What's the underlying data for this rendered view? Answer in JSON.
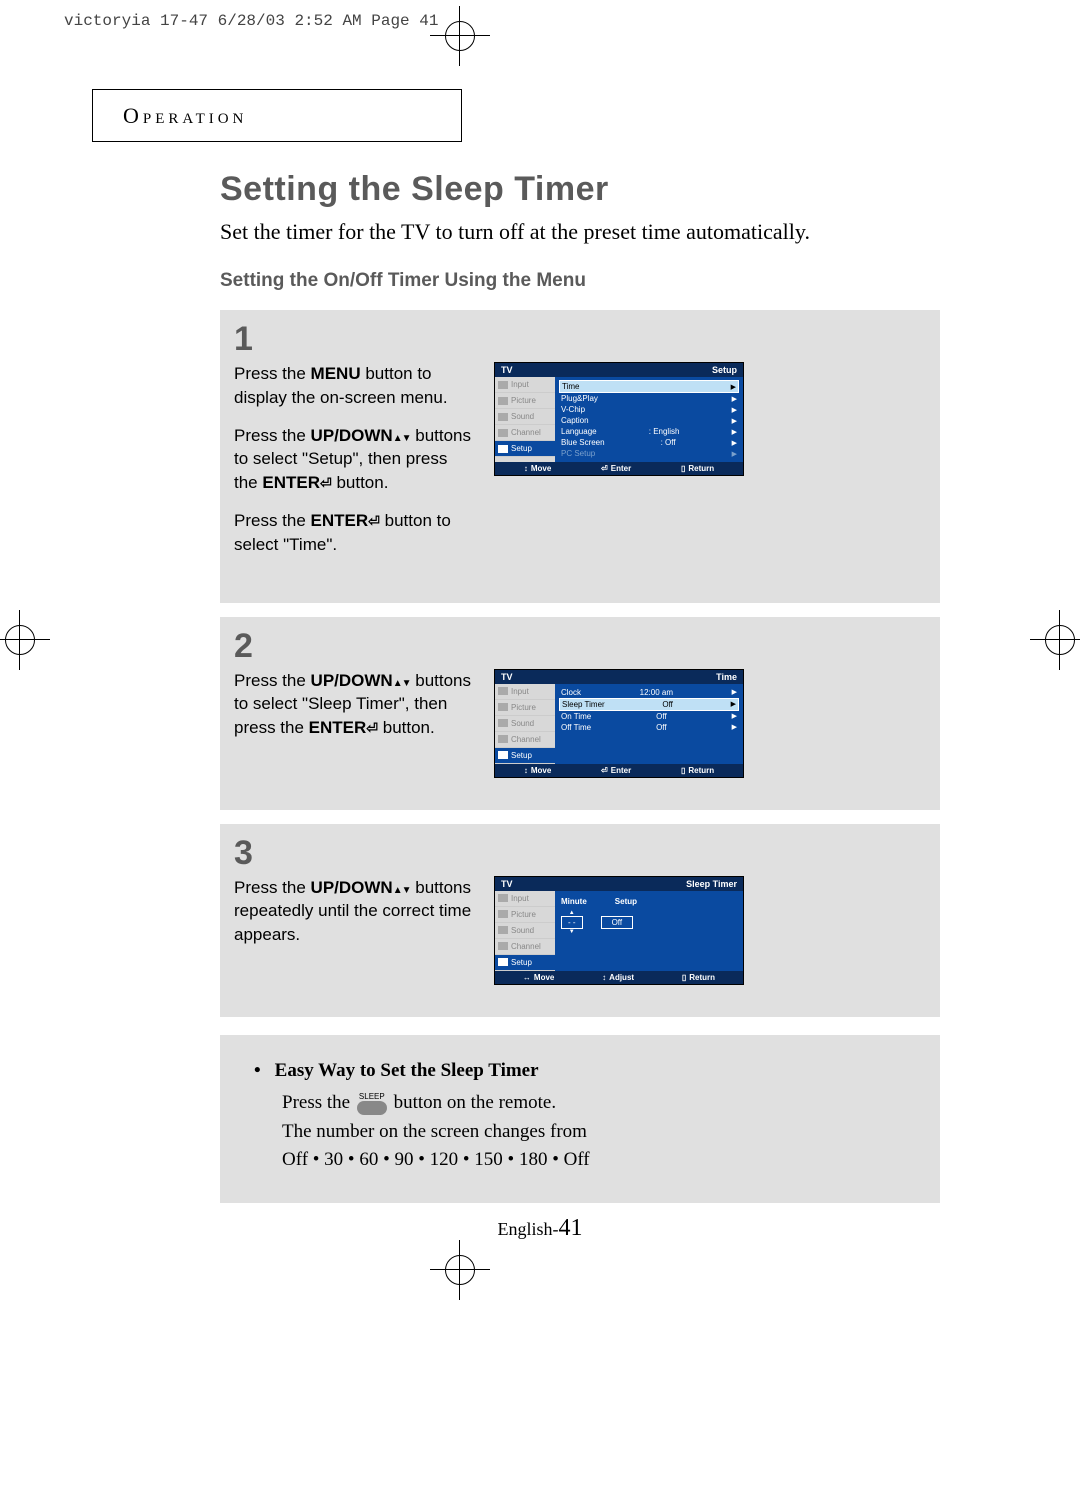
{
  "print_header": "victoryia 17-47  6/28/03 2:52 AM  Page 41",
  "section_label": "Operation",
  "title": "Setting the Sleep Timer",
  "intro": "Set the timer for the TV to turn off at the preset time automatically.",
  "subheading": "Setting the On/Off  Timer Using the Menu",
  "steps": {
    "s1": {
      "num": "1",
      "p1a": "Press the ",
      "p1b": "MENU",
      "p1c": " button to display the on-screen menu.",
      "p2a": "Press the ",
      "p2b": "UP/DOWN",
      "p2c": " buttons to select \"Setup\", then press the ",
      "p2d": "ENTER",
      "p2e": " button.",
      "p3a": "Press the ",
      "p3b": "ENTER",
      "p3c": " button to select \"Time\"."
    },
    "s2": {
      "num": "2",
      "p1a": "Press the ",
      "p1b": "UP/DOWN",
      "p1c": " buttons to select \"Sleep Timer\", then press the ",
      "p1d": "ENTER",
      "p1e": " button."
    },
    "s3": {
      "num": "3",
      "p1a": "Press the ",
      "p1b": "UP/DOWN",
      "p1c": " buttons repeatedly until the correct time appears."
    }
  },
  "osd": {
    "tv": "TV",
    "side": {
      "input": "Input",
      "picture": "Picture",
      "sound": "Sound",
      "channel": "Channel",
      "setup": "Setup"
    },
    "setup": {
      "title_right": "Setup",
      "time": "Time",
      "plugplay": "Plug&Play",
      "vchip": "V-Chip",
      "caption": "Caption",
      "language": "Language",
      "language_val": ": English",
      "bluescreen": "Blue Screen",
      "bluescreen_val": ": Off",
      "pcsetup": "PC Setup"
    },
    "time": {
      "title_right": "Time",
      "clock": "Clock",
      "clock_val": "12:00 am",
      "sleep": "Sleep Timer",
      "sleep_val": "Off",
      "on": "On Time",
      "on_val": "Off",
      "off": "Off Time",
      "off_val": "Off"
    },
    "sleeptimer": {
      "title_right": "Sleep Timer",
      "minute": "Minute",
      "setup": "Setup",
      "min_val": "- -",
      "setup_val": "Off"
    },
    "footer": {
      "move": "Move",
      "enter": "Enter",
      "adjust": "Adjust",
      "return": "Return"
    }
  },
  "easy": {
    "heading": "Easy Way to Set the Sleep Timer",
    "l1a": "Press the ",
    "l1b": " button on the remote.",
    "sleep_label": "SLEEP",
    "l2": "The number on the screen changes from",
    "l3": "Off • 30 • 60 • 90 • 120 • 150 • 180 • Off"
  },
  "page": {
    "prefix": "English-",
    "num": "41"
  }
}
